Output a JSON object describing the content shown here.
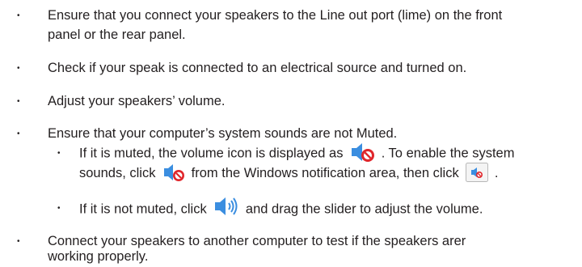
{
  "bullet_glyph": "•",
  "items": [
    {
      "line1": "Ensure that you connect your speakers to the Line out port (lime) on the front",
      "line2": "panel or the rear panel."
    },
    {
      "line1": "Check if your speak is connected to an electrical source and turned on."
    },
    {
      "line1": "Adjust your speakers’ volume."
    },
    {
      "line1": "Ensure that your computer’s system sounds are not Muted.",
      "sub": [
        {
          "part1": "If it is muted, the volume icon is displayed as",
          "part2": ". To enable the system",
          "part3": "sounds, click",
          "part4": "from the Windows notification area, then click",
          "part5": "."
        },
        {
          "part1": "If it is not muted, click",
          "part2": "and drag the slider to adjust the volume."
        }
      ]
    },
    {
      "line1": "Connect your speakers to another computer to test if the speakers arer",
      "line2": "working properly."
    }
  ],
  "icons": {
    "muted_speaker": "muted-speaker-icon",
    "unmute_button": "unmute-button-icon",
    "speaker": "speaker-icon"
  },
  "colors": {
    "text": "#231f20",
    "mute_red": "#e0262b",
    "speaker_blue": "#3b8ee0"
  }
}
